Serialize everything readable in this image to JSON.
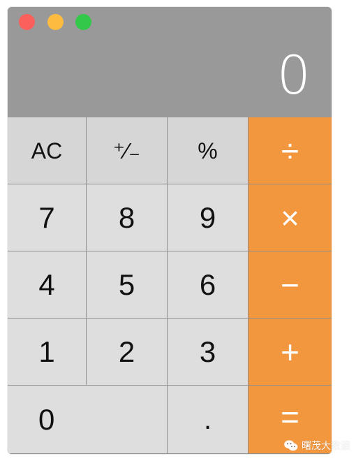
{
  "window": {
    "display_value": "0",
    "colors": {
      "display_bg": "#999999",
      "key_bg": "#dedede",
      "function_key_bg": "#d6d6d6",
      "operator_bg": "#f3973f",
      "close": "#fc605c",
      "minimize": "#fdbc40",
      "maximize": "#34c84a"
    }
  },
  "keys": {
    "ac": "AC",
    "plus_minus": "⁺∕₋",
    "percent": "%",
    "divide": "÷",
    "seven": "7",
    "eight": "8",
    "nine": "9",
    "multiply": "×",
    "four": "4",
    "five": "5",
    "six": "6",
    "minus": "−",
    "one": "1",
    "two": "2",
    "three": "3",
    "plus": "+",
    "zero": "0",
    "decimal": ".",
    "equals": "="
  },
  "watermark": {
    "text": "曙茂大数据",
    "icon": "wechat-icon"
  }
}
